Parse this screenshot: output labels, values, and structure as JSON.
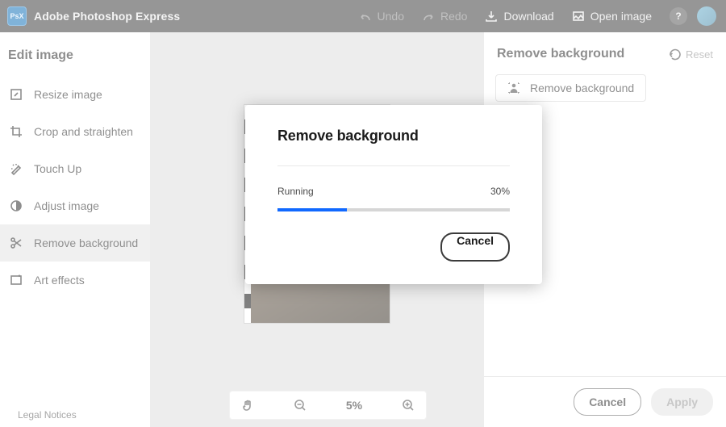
{
  "header": {
    "logo_text": "PsX",
    "app_title": "Adobe Photoshop Express",
    "undo_label": "Undo",
    "redo_label": "Redo",
    "download_label": "Download",
    "open_image_label": "Open image",
    "help_glyph": "?"
  },
  "sidebar": {
    "title": "Edit image",
    "items": [
      {
        "label": "Resize image"
      },
      {
        "label": "Crop and straighten"
      },
      {
        "label": "Touch Up"
      },
      {
        "label": "Adjust image"
      },
      {
        "label": "Remove background"
      },
      {
        "label": "Art effects"
      }
    ],
    "legal": "Legal Notices"
  },
  "zoom": {
    "value": "5%"
  },
  "right_panel": {
    "title": "Remove background",
    "reset_label": "Reset",
    "action_label": "Remove background",
    "cancel_label": "Cancel",
    "apply_label": "Apply"
  },
  "modal": {
    "title": "Remove background",
    "status_label": "Running",
    "percent_label": "30%",
    "progress_percent": 30,
    "cancel_label": "Cancel"
  }
}
